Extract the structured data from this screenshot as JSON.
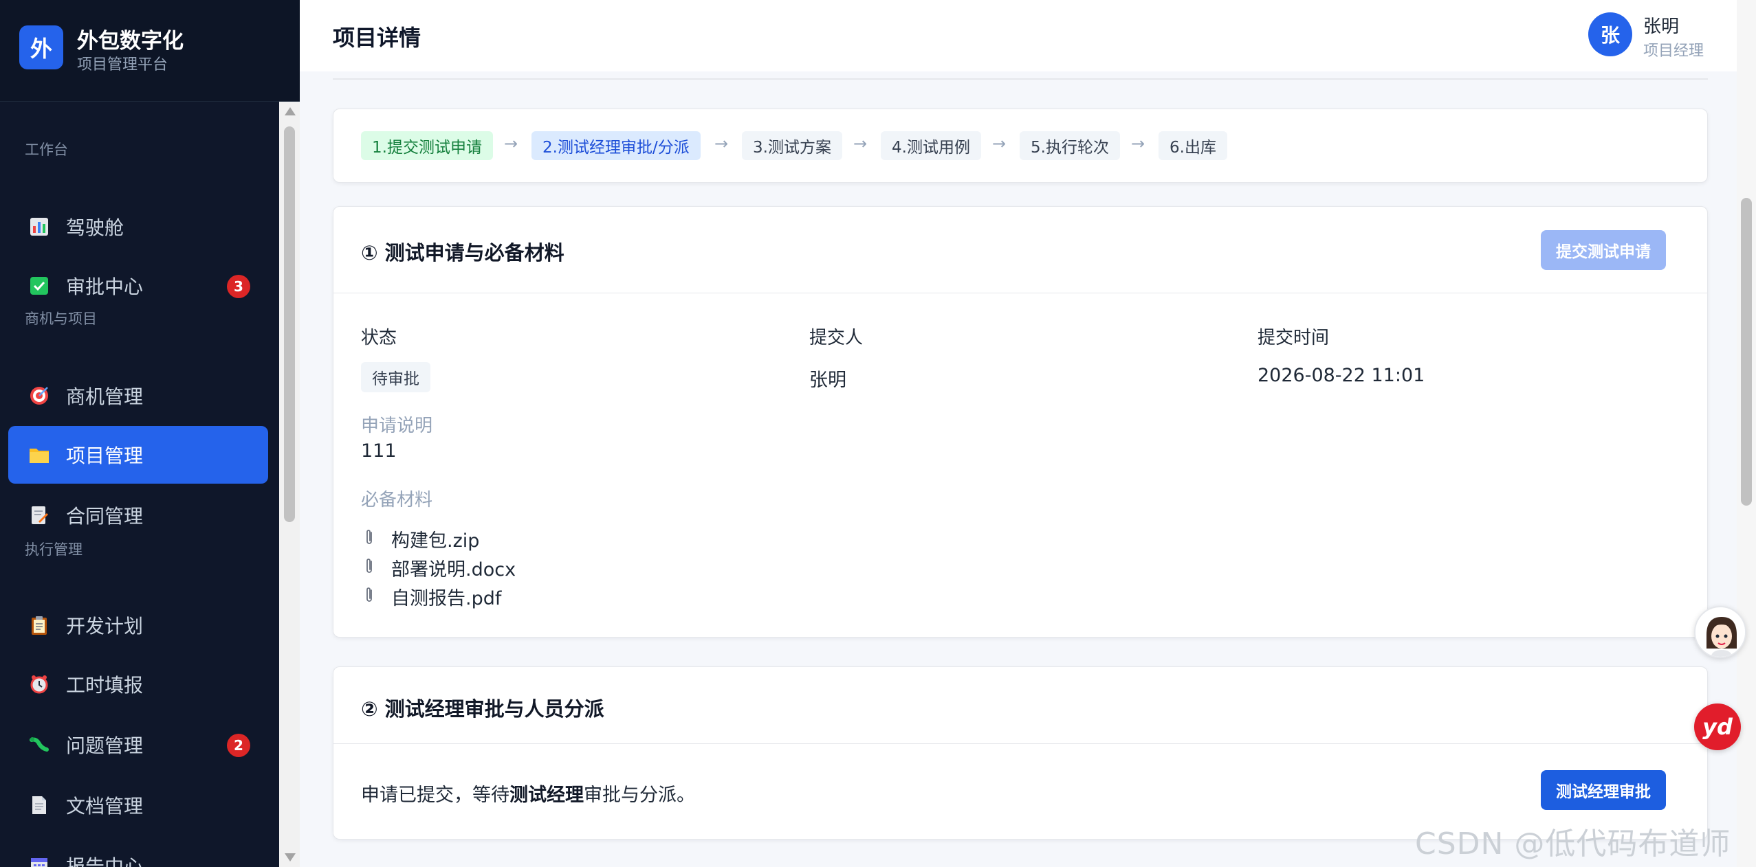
{
  "brand": {
    "logo_char": "外",
    "title": "外包数字化",
    "subtitle": "项目管理平台"
  },
  "sidebar": {
    "sections": [
      "工作台",
      "商机与项目",
      "执行管理"
    ],
    "items": [
      {
        "label": "驾驶舱",
        "icon": "bar-chart-icon",
        "badge": ""
      },
      {
        "label": "审批中心",
        "icon": "check-box-icon",
        "badge": "3"
      },
      {
        "label": "商机管理",
        "icon": "target-icon",
        "badge": ""
      },
      {
        "label": "项目管理",
        "icon": "folder-icon",
        "badge": "",
        "active": true
      },
      {
        "label": "合同管理",
        "icon": "contract-icon",
        "badge": ""
      },
      {
        "label": "开发计划",
        "icon": "clipboard-icon",
        "badge": ""
      },
      {
        "label": "工时填报",
        "icon": "clock-icon",
        "badge": ""
      },
      {
        "label": "问题管理",
        "icon": "bug-icon",
        "badge": "2"
      },
      {
        "label": "文档管理",
        "icon": "document-icon",
        "badge": ""
      },
      {
        "label": "报告中心",
        "icon": "calendar-icon",
        "badge": ""
      }
    ]
  },
  "header": {
    "title": "项目详情",
    "avatar_char": "张",
    "user_name": "张明",
    "user_role": "项目经理"
  },
  "steps": [
    {
      "label": "1.提交测试申请",
      "state": "done"
    },
    {
      "label": "2.测试经理审批/分派",
      "state": "current"
    },
    {
      "label": "3.测试方案",
      "state": "pending"
    },
    {
      "label": "4.测试用例",
      "state": "pending"
    },
    {
      "label": "5.执行轮次",
      "state": "pending"
    },
    {
      "label": "6.出库",
      "state": "pending"
    }
  ],
  "step_arrow": "→",
  "application": {
    "title": "① 测试申请与必备材料",
    "submit_button": "提交测试申请",
    "status_label": "状态",
    "status_value": "待审批",
    "submitter_label": "提交人",
    "submitter_value": "张明",
    "time_label": "提交时间",
    "time_value": "2026-08-22 11:01",
    "desc_label": "申请说明",
    "desc_value": "111",
    "materials_label": "必备材料",
    "materials": [
      "构建包.zip",
      "部署说明.docx",
      "自测报告.pdf"
    ]
  },
  "approval": {
    "title": "② 测试经理审批与人员分派",
    "desc_prefix": "申请已提交，等待",
    "desc_bold": "测试经理",
    "desc_suffix": "审批与分派。",
    "button": "测试经理审批"
  },
  "float": {
    "yd_label": "yd"
  },
  "watermark": "CSDN @低代码布道师",
  "colors": {
    "sidebar_bg": "#0f172a",
    "accent": "#2563eb",
    "badge": "#dc2626",
    "done_step_bg": "#dcfce7",
    "current_step_bg": "#dbeafe"
  }
}
